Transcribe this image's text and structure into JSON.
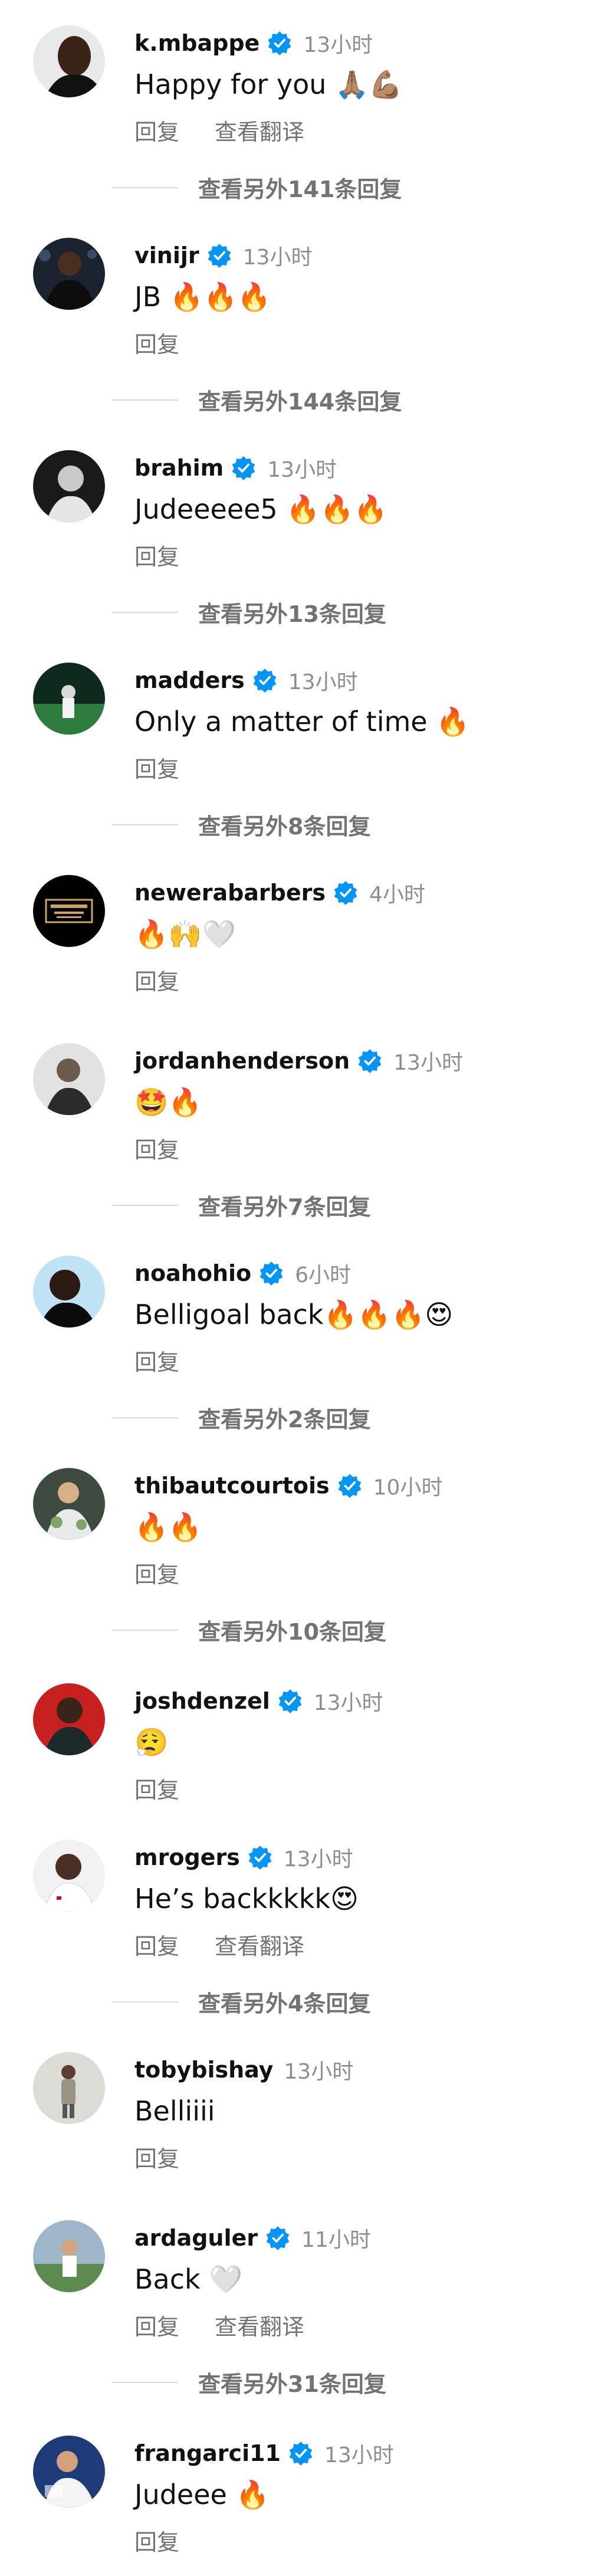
{
  "reply_label": "回复",
  "translate_label": "查看翻译",
  "comments": [
    {
      "username": "k.mbappe",
      "verified": true,
      "time": "13小时",
      "text": "Happy for you 🙏🏽💪🏽",
      "show_translate": true,
      "more_replies": "查看另外141条回复"
    },
    {
      "username": "vinijr",
      "verified": true,
      "time": "13小时",
      "text": "JB 🔥🔥🔥",
      "show_translate": false,
      "more_replies": "查看另外144条回复"
    },
    {
      "username": "brahim",
      "verified": true,
      "time": "13小时",
      "text": "Judeeeee5 🔥🔥🔥",
      "show_translate": false,
      "more_replies": "查看另外13条回复"
    },
    {
      "username": "madders",
      "verified": true,
      "time": "13小时",
      "text": "Only a matter of time 🔥",
      "show_translate": false,
      "more_replies": "查看另外8条回复"
    },
    {
      "username": "newerabarbers",
      "verified": true,
      "time": "4小时",
      "text": "🔥🙌🤍",
      "show_translate": false,
      "more_replies": ""
    },
    {
      "username": "jordanhenderson",
      "verified": true,
      "time": "13小时",
      "text": "🤩🔥",
      "show_translate": false,
      "more_replies": "查看另外7条回复"
    },
    {
      "username": "noahohio",
      "verified": true,
      "time": "6小时",
      "text": "Belligoal back🔥🔥🔥😍",
      "show_translate": false,
      "more_replies": "查看另外2条回复"
    },
    {
      "username": "thibautcourtois",
      "verified": true,
      "time": "10小时",
      "text": "🔥🔥",
      "show_translate": false,
      "more_replies": "查看另外10条回复"
    },
    {
      "username": "joshdenzel",
      "verified": true,
      "time": "13小时",
      "text": "😮‍💨",
      "show_translate": false,
      "more_replies": ""
    },
    {
      "username": "mrogers",
      "verified": true,
      "time": "13小时",
      "text": "He’s backkkkk😍",
      "show_translate": true,
      "more_replies": "查看另外4条回复"
    },
    {
      "username": "tobybishay",
      "verified": false,
      "time": "13小时",
      "text": "Belliiii",
      "show_translate": false,
      "more_replies": ""
    },
    {
      "username": "ardaguler",
      "verified": true,
      "time": "11小时",
      "text": "Back 🤍",
      "show_translate": true,
      "more_replies": "查看另外31条回复"
    },
    {
      "username": "frangarci11",
      "verified": true,
      "time": "13小时",
      "text": "Judeee 🔥",
      "show_translate": false,
      "more_replies": ""
    }
  ],
  "colors": {
    "verified_badge": "#0095f6",
    "secondary_text": "#737373",
    "timestamp": "#8e8e8e",
    "divider": "#dbdbdb"
  },
  "icons": {
    "verified": "verified-badge-icon"
  }
}
